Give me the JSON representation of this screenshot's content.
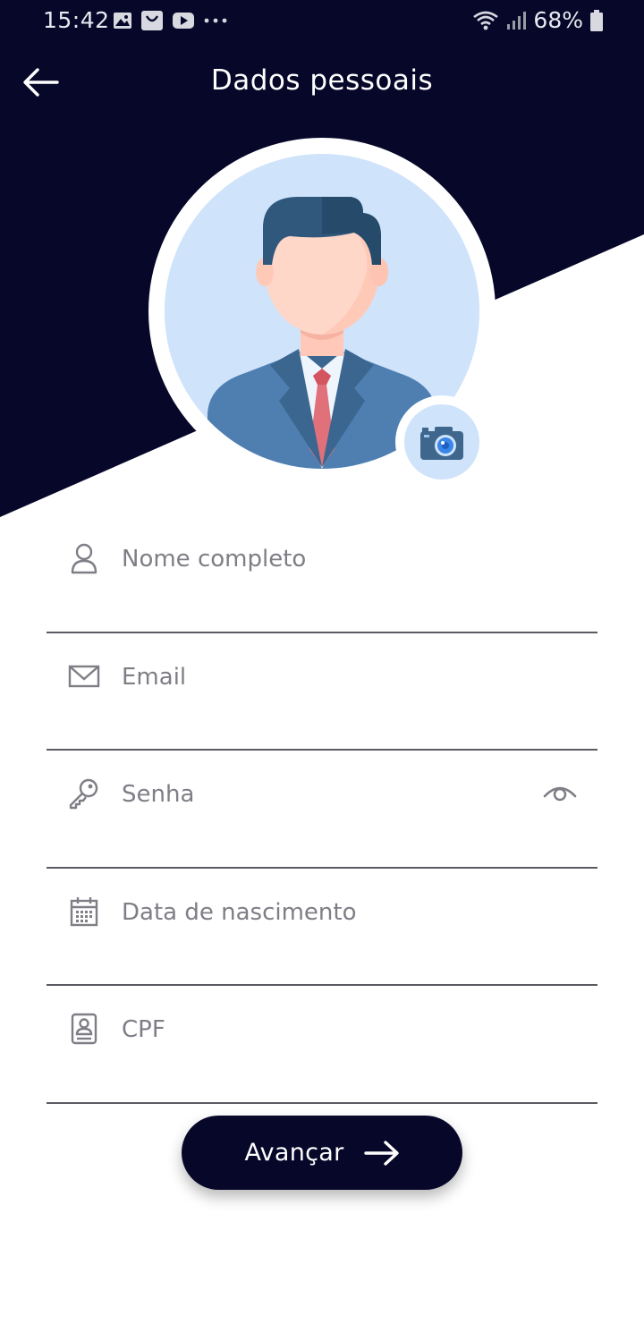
{
  "status_bar": {
    "time": "15:42",
    "battery_percent": "68%",
    "left_icons": [
      "gallery-icon",
      "notification-face-icon",
      "youtube-icon",
      "more-dots-icon"
    ],
    "right_icons": [
      "wifi-icon",
      "signal-icon",
      "battery-icon"
    ]
  },
  "header": {
    "title": "Dados pessoais",
    "back_icon": "arrow-left-icon"
  },
  "profile": {
    "avatar_icon": "user-avatar-icon",
    "camera_icon": "camera-icon"
  },
  "form": {
    "fields": [
      {
        "placeholder": "Nome completo",
        "icon": "user-icon",
        "value": ""
      },
      {
        "placeholder": "Email",
        "icon": "mail-icon",
        "value": ""
      },
      {
        "placeholder": "Senha",
        "icon": "key-icon",
        "value": "",
        "trailing_icon": "eye-icon"
      },
      {
        "placeholder": "Data de nascimento",
        "icon": "calendar-icon",
        "value": ""
      },
      {
        "placeholder": "CPF",
        "icon": "id-card-icon",
        "value": ""
      }
    ]
  },
  "actions": {
    "next_label": "Avançar",
    "next_icon": "arrow-right-icon"
  },
  "colors": {
    "header_background": "#07072a",
    "primary_button": "#07072a",
    "underline": "#5a5a62",
    "avatar_background": "#cfe3fb"
  }
}
